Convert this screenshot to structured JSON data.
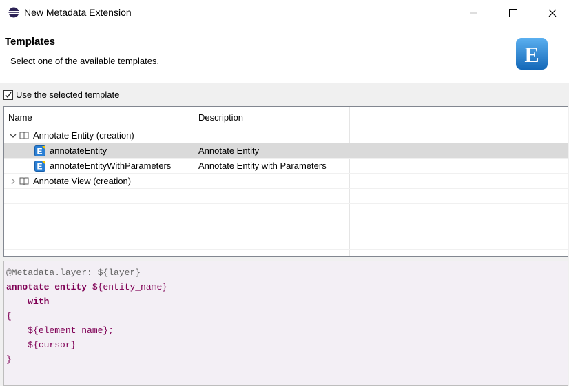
{
  "window": {
    "title": "New Metadata Extension"
  },
  "banner": {
    "heading": "Templates",
    "subtext": "Select one of the available templates.",
    "logo_letter": "E"
  },
  "options": {
    "use_selected_template_label": "Use the selected template",
    "use_selected_template_checked": true
  },
  "table": {
    "columns": [
      "Name",
      "Description"
    ],
    "rows": [
      {
        "type": "group",
        "expanded": true,
        "name": "Annotate Entity (creation)",
        "description": ""
      },
      {
        "type": "template",
        "selected": true,
        "name": "annotateEntity",
        "description": "Annotate Entity"
      },
      {
        "type": "template",
        "selected": false,
        "name": "annotateEntityWithParameters",
        "description": "Annotate Entity with Parameters"
      },
      {
        "type": "group",
        "expanded": false,
        "name": "Annotate View (creation)",
        "description": ""
      }
    ]
  },
  "preview": {
    "line1": "@Metadata.layer: ${layer}",
    "line2_kw": "annotate entity",
    "line2_var": " ${entity_name}",
    "line3_kw": "with",
    "line4": "{",
    "line5_var": "${element_name}",
    "line5_punct": ";",
    "line6_var": "${cursor}",
    "line7": "}"
  },
  "colors": {
    "selection": "#dadada",
    "preview_bg": "#f3eff5",
    "keyword": "#7f0055",
    "annotation": "#646464",
    "logo_blue": "#1e7fd0"
  }
}
